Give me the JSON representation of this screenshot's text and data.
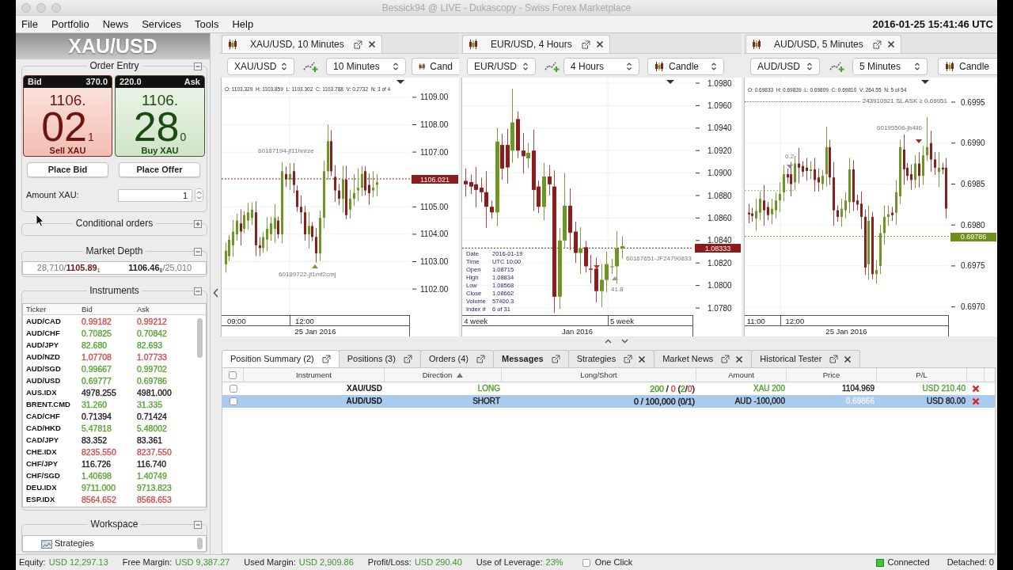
{
  "window": {
    "title": "Bessick94 @ LIVE - Dukascopy - Swiss Forex Marketplace"
  },
  "menu": [
    {
      "label": "File"
    },
    {
      "label": "Portfolio"
    },
    {
      "label": "News"
    },
    {
      "label": "Services"
    },
    {
      "label": "Tools"
    },
    {
      "label": "Help"
    }
  ],
  "clock": "2016-01-25 15:41:46 UTC",
  "left_panel": {
    "instrument": "XAU/USD",
    "order_entry": {
      "title": "Order Entry",
      "expanded": true,
      "bid": {
        "label": "Bid",
        "volume": "370.0",
        "price_prefix": "1106.",
        "price_main": "02",
        "price_pip": "1",
        "action": "Sell XAU"
      },
      "ask": {
        "label": "Ask",
        "volume": "220.0",
        "price_prefix": "1106.",
        "price_main": "28",
        "price_pip": "0",
        "action": "Buy XAU"
      },
      "buttons": [
        {
          "label": "Place Bid"
        },
        {
          "label": "Place Offer"
        }
      ],
      "amount": {
        "label": "Amount XAU:",
        "value": "1"
      }
    },
    "conditional_orders": {
      "title": "Conditional orders",
      "expanded": false
    },
    "market_depth": {
      "title": "Market Depth",
      "expanded": true,
      "bid": "28,710/**1105.89**$_{1}$",
      "ask": "**1106.46**$_{8}$/25,010"
    },
    "instruments": {
      "title": "Instruments",
      "expanded": true,
      "columns": [
        "Ticker",
        "Bid",
        "Ask"
      ],
      "rows": [
        {
          "ticker": "AUD/CAD",
          "bid": "0.99182",
          "ask": "0.99212",
          "color": "#d24b4b"
        },
        {
          "ticker": "AUD/CHF",
          "bid": "0.70825",
          "ask": "0.70842",
          "color": "#55a532"
        },
        {
          "ticker": "AUD/JPY",
          "bid": "82.680",
          "ask": "82.693",
          "color": "#55a532"
        },
        {
          "ticker": "AUD/NZD",
          "bid": "1.07708",
          "ask": "1.07733",
          "color": "#d24b4b"
        },
        {
          "ticker": "AUD/SGD",
          "bid": "0.99667",
          "ask": "0.99702",
          "color": "#55a532"
        },
        {
          "ticker": "AUD/USD",
          "bid": "0.69777",
          "ask": "0.69786",
          "color": "#55a532"
        },
        {
          "ticker": "AUS.IDX",
          "bid": "4978.255",
          "ask": "4981.000",
          "color": "#1a1a1a"
        },
        {
          "ticker": "BRENT.CMD",
          "bid": "31.260",
          "ask": "31.335",
          "color": "#55a532"
        },
        {
          "ticker": "CAD/CHF",
          "bid": "0.71394",
          "ask": "0.71424",
          "color": "#1a1a1a"
        },
        {
          "ticker": "CAD/HKD",
          "bid": "5.47818",
          "ask": "5.48002",
          "color": "#55a532"
        },
        {
          "ticker": "CAD/JPY",
          "bid": "83.352",
          "ask": "83.361",
          "color": "#1a1a1a"
        },
        {
          "ticker": "CHE.IDX",
          "bid": "8235.550",
          "ask": "8237.550",
          "color": "#d24b4b"
        },
        {
          "ticker": "CHF/JPY",
          "bid": "116.726",
          "ask": "116.740",
          "color": "#1a1a1a"
        },
        {
          "ticker": "CHF/SGD",
          "bid": "1.40698",
          "ask": "1.40749",
          "color": "#55a532"
        },
        {
          "ticker": "DEU.IDX",
          "bid": "9711.000",
          "ask": "9713.823",
          "color": "#55a532"
        },
        {
          "ticker": "ESP.IDX",
          "bid": "8564.652",
          "ask": "8568.653",
          "color": "#d24b4b"
        }
      ]
    },
    "workspace": {
      "title": "Workspace",
      "expanded": true,
      "items": [
        {
          "label": "Strategies"
        }
      ]
    }
  },
  "charts": [
    {
      "tab_title": "XAU/USD, 10 Minutes",
      "instrument": "XAU/USD",
      "period": "10 Minutes",
      "chart_type": "Cand",
      "info": "O: 1103.329  H: 1103.859  L: 1103.302  C: 1103.788  V: 0.2732  N: 3 of 4",
      "annotations": [
        {
          "text": "60187194-jf11hnrze"
        },
        {
          "text": "60189722-jf1mf2cmj"
        }
      ],
      "chart_data": {
        "type": "candlestick",
        "grid": true,
        "xlabel": "25 Jan 2016",
        "ylim": [
          1101.05,
          1109.72
        ],
        "yticks": [
          {
            "value": 1109,
            "label": "1109.00"
          },
          {
            "value": 1108,
            "label": "1108.00"
          },
          {
            "value": 1107,
            "label": "1107.00"
          },
          {
            "value": 1105,
            "label": "1105.00"
          },
          {
            "value": 1104,
            "label": "1104.00"
          },
          {
            "value": 1103,
            "label": "1103.00"
          },
          {
            "value": 1102,
            "label": "1102.00"
          }
        ],
        "ref_lines": [
          {
            "axis": "y",
            "value": 1106.021,
            "label": "1106.021",
            "color": "#8e1b1b"
          }
        ],
        "categories": [
          null,
          null,
          null,
          "09:00",
          null,
          null,
          null,
          null,
          null,
          null,
          null,
          null,
          null,
          null,
          null,
          null,
          null,
          null,
          null,
          null,
          null,
          "12:00",
          null,
          null,
          null,
          null,
          null,
          null,
          null,
          null,
          null,
          null,
          null,
          null,
          null,
          null,
          null,
          null,
          null,
          null,
          null,
          null,
          null,
          null,
          null,
          null,
          null,
          null,
          null
        ],
        "ohlc": [
          [
            1102.9,
            1103.7,
            1102.6,
            1103.4
          ],
          [
            1103.2,
            1103.98,
            1103.02,
            1103.8
          ],
          [
            1103.6,
            1104.52,
            1103.18,
            1104.1
          ],
          [
            1104.0,
            1104.74,
            1103.76,
            1104.5
          ],
          [
            1104.4,
            1104.91,
            1103.59,
            1104.1
          ],
          [
            1104.2,
            1104.85,
            1104.05,
            1104.7
          ],
          [
            1104.5,
            1105.13,
            1104.17,
            1104.8
          ],
          [
            1104.6,
            1105.17,
            1104.33,
            1104.9
          ],
          [
            1104.8,
            1105.19,
            1103.21,
            1103.6
          ],
          [
            1103.6,
            1103.9,
            1103.2,
            1103.5
          ],
          [
            1103.5,
            1104.08,
            1103.32,
            1103.9
          ],
          [
            1103.8,
            1104.62,
            1103.38,
            1104.2
          ],
          [
            1104.0,
            1104.64,
            1103.76,
            1104.4
          ],
          [
            1104.2,
            1105.11,
            1103.69,
            1104.6
          ],
          [
            1104.5,
            1104.65,
            1103.85,
            1104.0
          ],
          [
            1104.0,
            1106.63,
            1103.67,
            1106.3
          ],
          [
            1106.2,
            1106.47,
            1105.73,
            1106.0
          ],
          [
            1106.0,
            1106.59,
            1105.61,
            1106.2
          ],
          [
            1106.3,
            1106.6,
            1105.5,
            1105.8
          ],
          [
            1105.6,
            1105.78,
            1104.82,
            1105.0
          ],
          [
            1105.0,
            1105.42,
            1104.38,
            1104.8
          ],
          [
            1104.8,
            1105.04,
            1103.76,
            1104.0
          ],
          [
            1104.0,
            1104.81,
            1103.49,
            1104.3
          ],
          [
            1104.3,
            1104.45,
            1103.75,
            1103.9
          ],
          [
            1103.9,
            1104.23,
            1102.97,
            1103.3
          ],
          [
            1103.3,
            1104.87,
            1103.03,
            1104.6
          ],
          [
            1104.6,
            1106.69,
            1104.21,
            1106.3
          ],
          [
            1106.3,
            1108.0,
            1106.0,
            1107.4
          ],
          [
            1107.4,
            1107.8,
            1106.12,
            1106.3
          ],
          [
            1106.1,
            1106.52,
            1105.18,
            1105.6
          ],
          [
            1105.6,
            1105.84,
            1105.06,
            1105.3
          ],
          [
            1105.3,
            1106.51,
            1104.79,
            1106.0
          ],
          [
            1106.0,
            1106.5,
            1104.55,
            1104.7
          ],
          [
            1104.9,
            1105.63,
            1104.57,
            1105.3
          ],
          [
            1105.3,
            1106.2,
            1105.03,
            1105.5
          ],
          [
            1105.6,
            1106.4,
            1105.21,
            1105.7
          ],
          [
            1105.7,
            1106.5,
            1105.4,
            1106.2
          ],
          [
            1106.3,
            1106.48,
            1105.42,
            1105.6
          ],
          [
            1105.8,
            1106.22,
            1105.08,
            1105.5
          ],
          [
            1105.6,
            1106.3,
            1105.36,
            1105.7
          ],
          [
            1105.8,
            1106.2,
            1105.39,
            1105.9
          ],
          null,
          null,
          null,
          null,
          null,
          null,
          null,
          null
        ]
      }
    },
    {
      "tab_title": "EUR/USD, 4 Hours",
      "instrument": "EUR/USD",
      "period": "4 Hours",
      "chart_type": "Candle",
      "data_box": [
        {
          "label": "Date",
          "value": "2016-01-19"
        },
        {
          "label": "Time",
          "value": "UTC 10:00"
        },
        {
          "label": "Open",
          "value": "1.08715"
        },
        {
          "label": "High",
          "value": "1.08834"
        },
        {
          "label": "Low",
          "value": "1.08568"
        },
        {
          "label": "Close",
          "value": "1.08662"
        },
        {
          "label": "Volume",
          "value": "57400.3"
        },
        {
          "label": "Index #",
          "value": "6 of 31"
        }
      ],
      "annotations": [
        {
          "text": "60167651-JF24790833"
        },
        {
          "text": "41.8"
        }
      ],
      "chart_data": {
        "type": "candlestick",
        "grid": true,
        "xlabel": "Jan 2016",
        "ylim": [
          1.07737,
          1.09849
        ],
        "yticks": [
          {
            "value": 1.098,
            "label": "1.0980"
          },
          {
            "value": 1.096,
            "label": "1.0960"
          },
          {
            "value": 1.094,
            "label": "1.0940"
          },
          {
            "value": 1.092,
            "label": "1.0920"
          },
          {
            "value": 1.09,
            "label": "1.0900"
          },
          {
            "value": 1.088,
            "label": "1.0880"
          },
          {
            "value": 1.086,
            "label": "1.0860"
          },
          {
            "value": 1.084,
            "label": "1.0840"
          },
          {
            "value": 1.082,
            "label": "1.0820"
          },
          {
            "value": 1.08,
            "label": "1.0800"
          },
          {
            "value": 1.078,
            "label": "1.0780"
          }
        ],
        "ref_lines": [
          {
            "axis": "y",
            "value": 1.08333,
            "label": "1.08333",
            "color": "#8e1b1b"
          }
        ],
        "categories": [
          null,
          null,
          "4 week",
          null,
          null,
          null,
          null,
          null,
          null,
          null,
          null,
          null,
          null,
          null,
          null,
          null,
          null,
          null,
          null,
          null,
          null,
          null,
          null,
          null,
          null,
          null,
          null,
          null,
          null,
          null,
          "5 week",
          null,
          null,
          null,
          null,
          null,
          null,
          null,
          null,
          null,
          null,
          null,
          null,
          null
        ],
        "ohlc": [
          [
            1.0893,
            1.0904,
            1.0879,
            1.089
          ],
          [
            1.0892,
            1.08986,
            1.08814,
            1.0888
          ],
          [
            1.089,
            1.09054,
            1.08696,
            1.0885
          ],
          [
            1.0887,
            1.08958,
            1.08742,
            1.0883
          ],
          [
            1.0883,
            1.09017,
            1.08513,
            1.087
          ],
          [
            1.087,
            1.08755,
            1.08595,
            1.0865
          ],
          [
            1.0865,
            1.09401,
            1.08529,
            1.0928
          ],
          [
            1.0925,
            1.09349,
            1.08941,
            1.0904
          ],
          [
            1.0925,
            1.09393,
            1.08907,
            1.0905
          ],
          [
            1.092,
            1.0975,
            1.0909,
            1.0945
          ],
          [
            1.0948,
            1.09546,
            1.09134,
            1.092
          ],
          [
            1.092,
            1.09354,
            1.08996,
            1.0915
          ],
          [
            1.0913,
            1.09268,
            1.09042,
            1.0918
          ],
          [
            1.092,
            1.09387,
            1.08663,
            1.0885
          ],
          [
            1.0888,
            1.08935,
            1.08645,
            1.087
          ],
          [
            1.087,
            1.09091,
            1.08579,
            1.0897
          ],
          [
            1.0897,
            1.09069,
            1.08801,
            1.089
          ],
          [
            1.0888,
            1.09023,
            1.07757,
            1.079
          ],
          [
            1.079,
            1.0851,
            1.0779,
            1.084
          ],
          [
            1.084,
            1.09,
            1.08334,
            1.0871
          ],
          [
            1.0871,
            1.08864,
            1.08316,
            1.0847
          ],
          [
            1.0848,
            1.08568,
            1.08202,
            1.0829
          ],
          [
            1.0829,
            1.08517,
            1.08103,
            1.0833
          ],
          [
            1.0834,
            1.08395,
            1.08115,
            1.0817
          ],
          [
            1.0815,
            1.08271,
            1.08019,
            1.0814
          ],
          [
            1.0815,
            1.08249,
            1.07851,
            1.0795
          ],
          [
            1.0795,
            1.08193,
            1.07807,
            1.0805
          ],
          [
            1.0805,
            1.083,
            1.0794,
            1.0819
          ],
          [
            1.0817,
            1.08236,
            1.08104,
            1.0817
          ],
          [
            1.0817,
            1.08484,
            1.08016,
            1.0833
          ],
          [
            1.0833,
            1.08438,
            1.08242,
            1.0835
          ],
          null,
          null,
          null,
          null,
          null,
          null,
          null,
          null,
          null,
          null,
          null,
          null,
          null
        ]
      }
    },
    {
      "tab_title": "AUD/USD, 5 Minutes",
      "instrument": "AUD/USD",
      "period": "5 Minutes",
      "chart_type": "Candle",
      "info": "O: 0.69833  H: 0.69839  L: 0.69809  C: 0.69810  V: 264.55  N: 5 of 54",
      "annotations": [
        {
          "text": "60195506-jb4ll6"
        },
        {
          "text": "0.2"
        }
      ],
      "chart_data": {
        "type": "candlestick",
        "grid": true,
        "xlabel": "25 Jan 2016",
        "ylim": [
          0.6969,
          0.6998
        ],
        "yticks": [
          {
            "value": 0.6995,
            "label": "0.6995"
          },
          {
            "value": 0.699,
            "label": "0.6990"
          },
          {
            "value": 0.6985,
            "label": "0.6985"
          },
          {
            "value": 0.698,
            "label": "0.6980"
          },
          {
            "value": 0.6975,
            "label": "0.6975"
          },
          {
            "value": 0.697,
            "label": "0.6970"
          }
        ],
        "ref_lines": [
          {
            "axis": "y",
            "value": 0.69951,
            "label": "243910921 SL ASK ≥ 0.69951"
          },
          {
            "axis": "y",
            "value": 0.69842,
            "color": "#9aaa70"
          },
          {
            "axis": "y",
            "value": 0.69786,
            "label": "0.69786",
            "color": "#6f8f1c"
          }
        ],
        "categories": [
          null,
          null,
          "11:00",
          null,
          null,
          null,
          null,
          null,
          null,
          null,
          null,
          null,
          "12:00",
          null,
          null,
          null,
          null,
          null,
          null,
          null,
          null,
          null,
          null,
          null,
          null,
          null,
          null,
          null,
          null,
          null,
          null,
          null,
          null,
          null,
          null,
          null,
          null,
          null,
          null,
          null,
          null,
          null,
          null,
          null,
          null,
          null,
          null,
          null,
          null,
          null,
          null,
          null
        ],
        "ohlc": [
          [
            0.69815,
            0.69826,
            0.69802,
            0.69813
          ],
          [
            0.69814,
            0.69821,
            0.69804,
            0.69811
          ],
          [
            0.69808,
            0.69832,
            0.69793,
            0.69817
          ],
          [
            0.69815,
            0.69841,
            0.69806,
            0.69832
          ],
          [
            0.6983,
            0.69849,
            0.69799,
            0.69818
          ],
          [
            0.69822,
            0.69828,
            0.69806,
            0.69812
          ],
          [
            0.69813,
            0.69832,
            0.69801,
            0.6982
          ],
          [
            0.69818,
            0.6984,
            0.69808,
            0.6983
          ],
          [
            0.6983,
            0.69852,
            0.69816,
            0.69838
          ],
          [
            0.6984,
            0.69873,
            0.69829,
            0.69862
          ],
          [
            0.69862,
            0.69869,
            0.69851,
            0.69858
          ],
          [
            0.69862,
            0.69877,
            0.69835,
            0.6985
          ],
          [
            0.69852,
            0.69884,
            0.69843,
            0.69875
          ],
          [
            0.69875,
            0.69894,
            0.69851,
            0.6987
          ],
          [
            0.69872,
            0.69878,
            0.69859,
            0.69865
          ],
          [
            0.6987,
            0.69882,
            0.69854,
            0.69866
          ],
          [
            0.69866,
            0.69878,
            0.69856,
            0.69868
          ],
          [
            0.69868,
            0.69882,
            0.69841,
            0.69855
          ],
          [
            0.69858,
            0.69869,
            0.69841,
            0.69852
          ],
          [
            0.6985,
            0.69867,
            0.69843,
            0.6986
          ],
          [
            0.69862,
            0.6992,
            0.69847,
            0.69895
          ],
          [
            0.69895,
            0.69904,
            0.69849,
            0.69858
          ],
          [
            0.69858,
            0.69877,
            0.69799,
            0.69818
          ],
          [
            0.69818,
            0.69824,
            0.69804,
            0.6981
          ],
          [
            0.6981,
            0.69832,
            0.69798,
            0.6982
          ],
          [
            0.69818,
            0.6984,
            0.69808,
            0.6983
          ],
          [
            0.69828,
            0.69882,
            0.69814,
            0.69868
          ],
          [
            0.69868,
            0.69879,
            0.69817,
            0.69828
          ],
          [
            0.6983,
            0.69837,
            0.69818,
            0.69825
          ],
          [
            0.69826,
            0.69841,
            0.69795,
            0.6981
          ],
          [
            0.6981,
            0.69819,
            0.69739,
            0.69748
          ],
          [
            0.69752,
            0.69824,
            0.69733,
            0.69805
          ],
          [
            0.6981,
            0.69816,
            0.69734,
            0.6974
          ],
          [
            0.6974,
            0.69757,
            0.69728,
            0.69745
          ],
          [
            0.6975,
            0.698,
            0.6974,
            0.6979
          ],
          [
            0.6979,
            0.69824,
            0.69776,
            0.6981
          ],
          [
            0.6981,
            0.69824,
            0.69799,
            0.69813
          ],
          [
            0.69815,
            0.69822,
            0.69805,
            0.69812
          ],
          [
            0.69815,
            0.69855,
            0.698,
            0.6984
          ],
          [
            0.69835,
            0.69904,
            0.69826,
            0.69895
          ],
          [
            0.69892,
            0.69911,
            0.69849,
            0.69868
          ],
          [
            0.6987,
            0.69876,
            0.69854,
            0.6986
          ],
          [
            0.69862,
            0.69874,
            0.69843,
            0.69855
          ],
          [
            0.69855,
            0.69885,
            0.69845,
            0.69875
          ],
          [
            0.69875,
            0.69889,
            0.69846,
            0.6986
          ],
          [
            0.6986,
            0.69896,
            0.69849,
            0.69885
          ],
          [
            0.69885,
            0.69932,
            0.69878,
            0.69895
          ],
          [
            0.699,
            0.69915,
            0.69865,
            0.6988
          ],
          [
            0.6988,
            0.69889,
            0.69861,
            0.6987
          ],
          [
            0.69865,
            0.69889,
            0.69846,
            0.6987
          ],
          [
            0.6987,
            0.69876,
            0.69862,
            0.69868
          ],
          [
            0.6987,
            0.69882,
            0.69808,
            0.6982
          ]
        ]
      }
    }
  ],
  "bottom_panel": {
    "tabs": [
      {
        "label": "Position Summary (2)",
        "selected": true,
        "unread": false,
        "closable": false
      },
      {
        "label": "Positions (3)",
        "selected": false,
        "unread": false,
        "closable": false
      },
      {
        "label": "Orders (4)",
        "selected": false,
        "unread": false,
        "closable": false
      },
      {
        "label": "Messages",
        "selected": false,
        "unread": true,
        "closable": false
      },
      {
        "label": "Strategies",
        "selected": false,
        "unread": false,
        "closable": true
      },
      {
        "label": "Market News",
        "selected": false,
        "unread": false,
        "closable": true
      },
      {
        "label": "Historical Tester",
        "selected": false,
        "unread": false,
        "closable": true
      }
    ],
    "table": {
      "all_checked": false,
      "columns": [
        {
          "label": "Instrument",
          "sorted": false
        },
        {
          "label": "Direction",
          "sorted": true
        },
        {
          "label": "Long/Short",
          "sorted": false
        },
        {
          "label": "Amount",
          "sorted": false
        },
        {
          "label": "Price",
          "sorted": false
        },
        {
          "label": "P/L",
          "sorted": false
        }
      ],
      "rows": [
        {
          "selected": false,
          "checked": false,
          "instrument": "XAU/USD",
          "direction": {
            "text": "LONG",
            "color": "#4fa12c"
          },
          "long_short": [
            {
              "text": "200",
              "color": "#4fa12c"
            },
            {
              "text": " / "
            },
            {
              "text": "0",
              "color": "#d24b4b"
            },
            {
              "text": " ("
            },
            {
              "text": "2",
              "color": "#4fa12c"
            },
            {
              "text": "/"
            },
            {
              "text": "0",
              "color": "#d24b4b"
            },
            {
              "text": ")"
            }
          ],
          "amount": {
            "text": "XAU 200",
            "color": "#4fa12c"
          },
          "price": {
            "text": "1104.969",
            "color": "#1a1a1a"
          },
          "pl": {
            "text": "USD 210.40",
            "color": "#4fa12c"
          }
        },
        {
          "selected": true,
          "checked": false,
          "instrument": "AUD/USD",
          "direction": {
            "text": "SHORT",
            "color": "#1a1a1a"
          },
          "long_short": [
            {
              "text": "0 / 100,000 (0/1)",
              "color": "#1a1a1a"
            }
          ],
          "amount": {
            "text": "AUD -100,000",
            "color": "#1a1a1a"
          },
          "price": {
            "text": "0.69866",
            "color": "#eef4fb"
          },
          "pl": {
            "text": "USD 80.00",
            "color": "#1a1a1a"
          }
        }
      ]
    }
  },
  "status_bar": {
    "metrics": [
      {
        "label": "Equity:",
        "value": "USD 12,297.13"
      },
      {
        "label": "Free Margin:",
        "value": "USD 9,387.27"
      },
      {
        "label": "Used Margin:",
        "value": "USD 2,909.86"
      },
      {
        "label": "Profit/Loss:",
        "value": "USD 290.40"
      },
      {
        "label": "Use of Leverage:",
        "value": "23%"
      }
    ],
    "one_click": {
      "label": "One Click",
      "checked": false
    },
    "connection": {
      "label": "Connected",
      "connected": true
    },
    "detached": "Detached: 0"
  }
}
